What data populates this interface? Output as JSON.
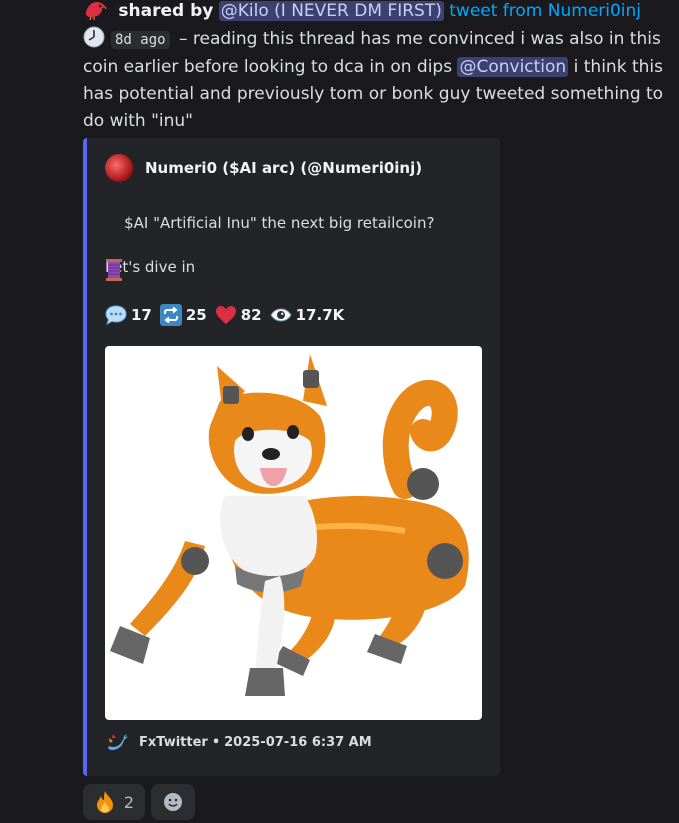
{
  "header": {
    "shared_by_label": "shared by",
    "sharer_mention": "@Kilo (I NEVER DM FIRST)",
    "tweet_link": "tweet from Numeri0inj"
  },
  "message": {
    "timestamp": "8d ago",
    "text_before_mention": "– reading this thread has me convinced i was also in this coin earlier before looking to dca in on dips",
    "mention": "@Conviction",
    "text_after_mention": "i think this has potential and previously tom or bonk guy tweeted something to do with \"inu\""
  },
  "embed": {
    "accent_color": "#5865f2",
    "author": "Numeri0 ($AI arc) (@Numeri0inj)",
    "description": "$AI \"Artificial Inu\" the next big retailcoin?\n\nLet's dive in",
    "stats": {
      "replies": "17",
      "retweets": "25",
      "likes": "82",
      "views": "17.7K"
    },
    "footer": {
      "source": "FxTwitter",
      "separator": "•",
      "datetime": "2025-07-16 6:37 AM"
    }
  },
  "reactions": [
    {
      "emoji": "fire-emoji",
      "count": "2"
    },
    {
      "emoji": "add-reaction-icon"
    }
  ]
}
